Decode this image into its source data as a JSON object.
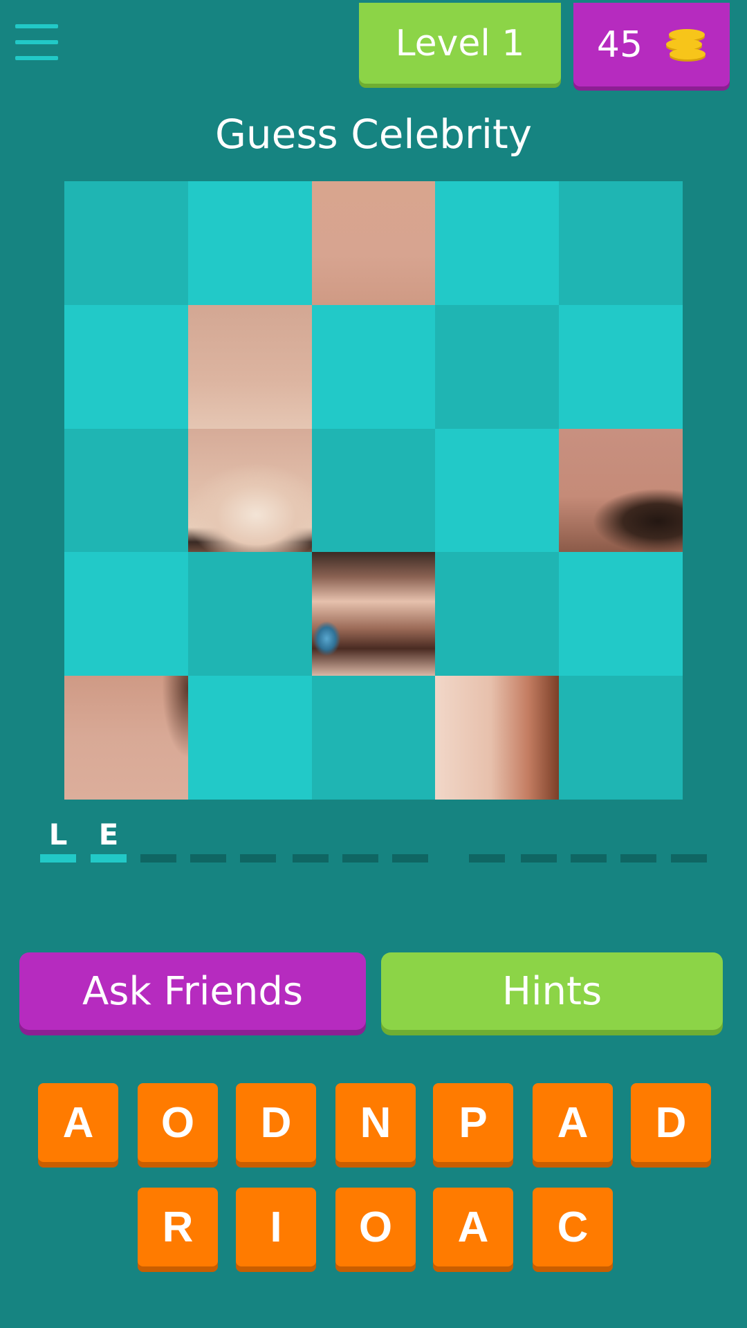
{
  "header": {
    "level_label": "Level 1",
    "coins": "45",
    "coin_icon": "coin-stack-icon",
    "menu_icon": "hamburger-menu-icon"
  },
  "title": "Guess Celebrity",
  "puzzle": {
    "revealed_tiles": [
      "r1c3",
      "r2c2",
      "r3c2",
      "r3c5",
      "r4c3",
      "r5c1",
      "r5c4"
    ]
  },
  "answer": {
    "word1": [
      "L",
      "E",
      "",
      "",
      "",
      "",
      "",
      ""
    ],
    "word2": [
      "",
      "",
      "",
      "",
      ""
    ]
  },
  "buttons": {
    "ask_friends": "Ask Friends",
    "hints": "Hints"
  },
  "letters": {
    "row1": [
      "A",
      "O",
      "D",
      "N",
      "P",
      "A",
      "D"
    ],
    "row2": [
      "R",
      "I",
      "O",
      "A",
      "C"
    ]
  },
  "colors": {
    "background": "#168481",
    "tile_dark": "#1fb5b3",
    "tile_light": "#22c9c8",
    "green": "#8cd447",
    "purple": "#b62bbf",
    "orange": "#ff7b00",
    "coin": "#f7c51a"
  }
}
